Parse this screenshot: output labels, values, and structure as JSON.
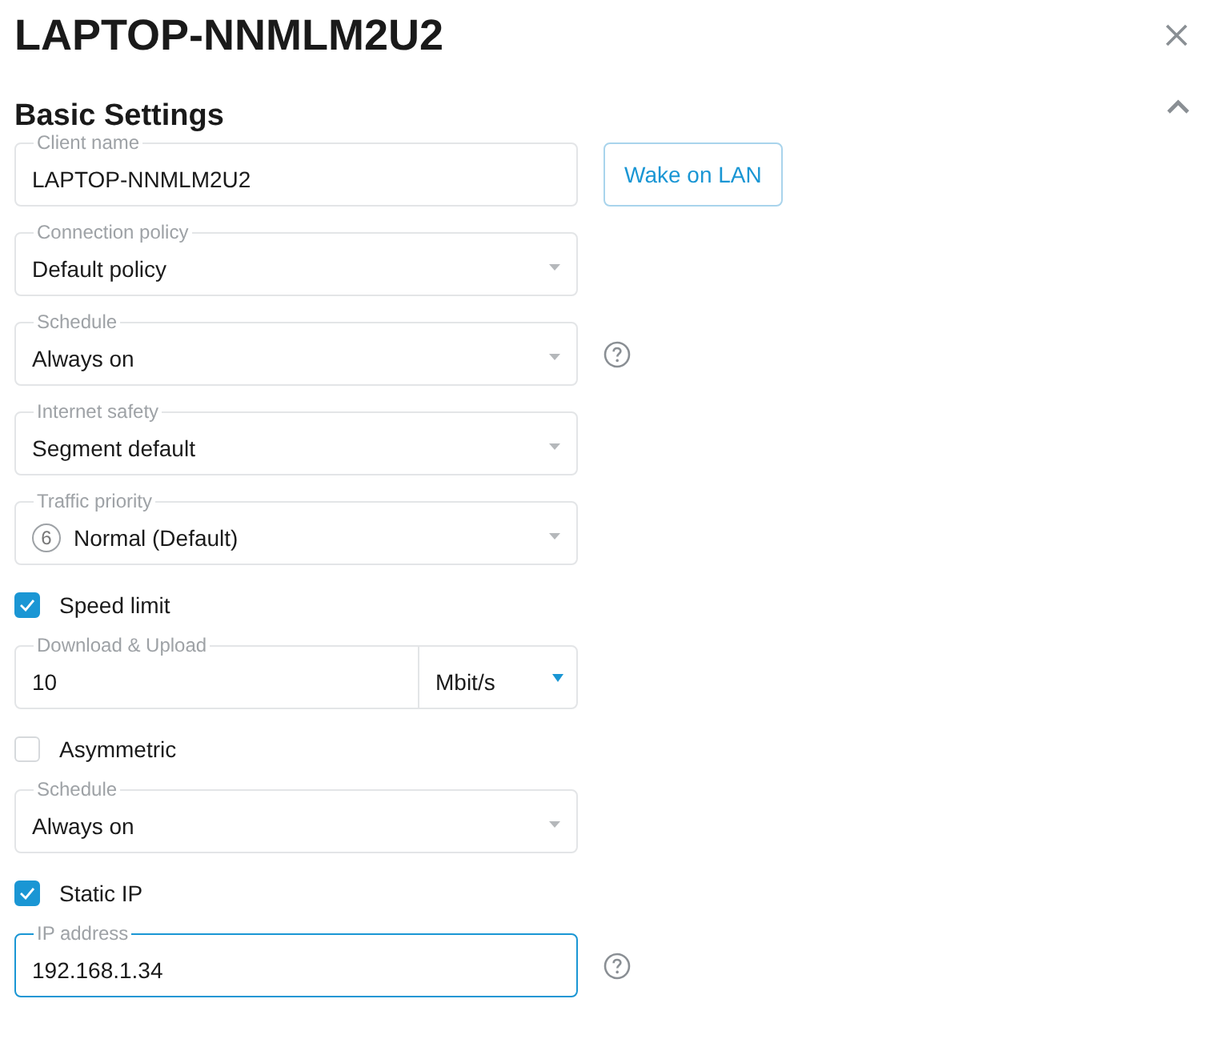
{
  "title": "LAPTOP-NNMLM2U2",
  "section": {
    "title": "Basic Settings",
    "expanded": true
  },
  "fields": [
    {
      "kind": "text",
      "label": "Client name",
      "value": "LAPTOP-NNMLM2U2",
      "button": "Wake on LAN"
    },
    {
      "kind": "select",
      "label": "Connection policy",
      "value": "Default policy"
    },
    {
      "kind": "select",
      "label": "Schedule",
      "value": "Always on",
      "help": true
    },
    {
      "kind": "select",
      "label": "Internet safety",
      "value": "Segment default"
    },
    {
      "kind": "select",
      "label": "Traffic priority",
      "value": "Normal (Default)",
      "badge": "6"
    },
    {
      "kind": "checkbox",
      "label": "Speed limit",
      "checked": true
    },
    {
      "kind": "unit",
      "label": "Download & Upload",
      "value": "10",
      "unit": "Mbit/s"
    },
    {
      "kind": "checkbox",
      "label": "Asymmetric",
      "checked": false
    },
    {
      "kind": "select",
      "label": "Schedule",
      "value": "Always on"
    },
    {
      "kind": "checkbox",
      "label": "Static IP",
      "checked": true
    },
    {
      "kind": "text",
      "label": "IP address",
      "value": "192.168.1.34",
      "focused": true,
      "help": true
    }
  ]
}
